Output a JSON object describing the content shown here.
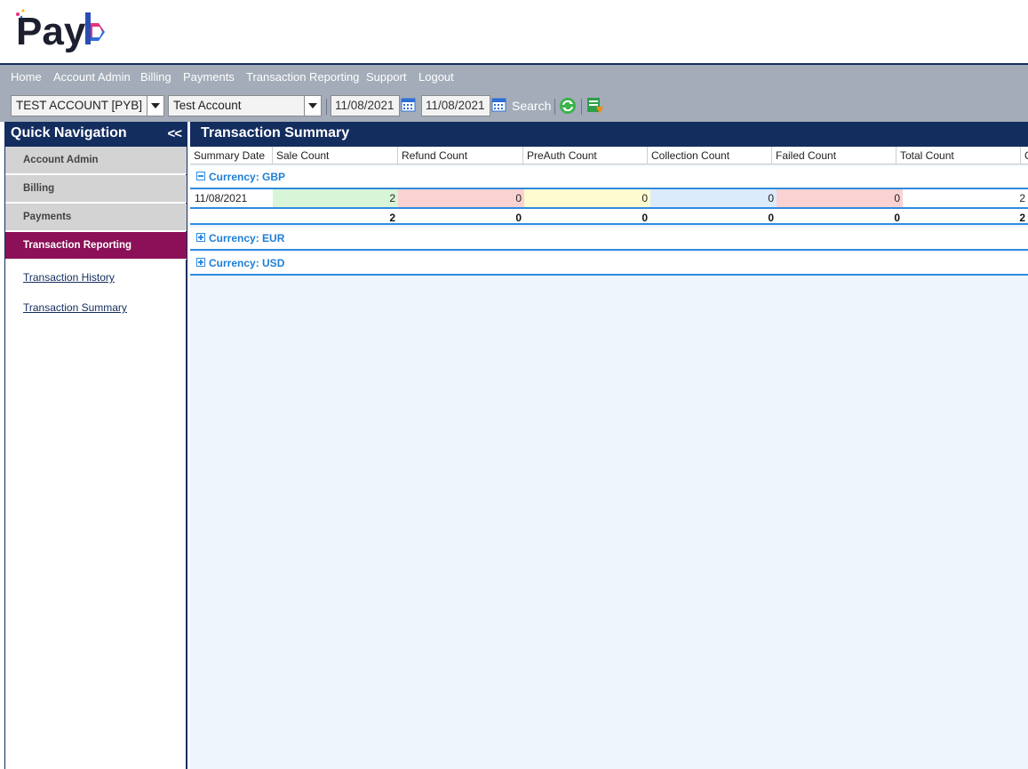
{
  "brand": {
    "logo_text": "Payb",
    "accent_pink": "#8b1057",
    "navy": "#132d5e"
  },
  "topnav": [
    "Home",
    "Account Admin",
    "Billing",
    "Payments",
    "Transaction Reporting",
    "Support",
    "Logout"
  ],
  "toolbar": {
    "account_select": "TEST ACCOUNT [PYB]",
    "merchant_select": "Test Account",
    "date_from": "11/08/2021",
    "date_to": "11/08/2021",
    "search_label": "Search",
    "icons": [
      "calendar-icon",
      "calendar-icon",
      "refresh-icon",
      "export-icon"
    ]
  },
  "sidebar": {
    "title": "Quick Navigation",
    "collapse_label": "<<",
    "sections": [
      "Account Admin",
      "Billing",
      "Payments",
      "Transaction Reporting"
    ],
    "active_section": "Transaction Reporting",
    "links": [
      "Transaction History",
      "Transaction Summary"
    ]
  },
  "main": {
    "title": "Transaction Summary",
    "columns": [
      "Summary Date",
      "Sale Count",
      "Refund Count",
      "PreAuth Count",
      "Collection Count",
      "Failed Count",
      "Total Count",
      "C"
    ],
    "groups": [
      {
        "label": "Currency: GBP",
        "expanded": true,
        "rows": [
          {
            "date": "11/08/2021",
            "sale": "2",
            "refund": "0",
            "preauth": "0",
            "collection": "0",
            "failed": "0",
            "total": "2"
          }
        ],
        "totals": {
          "sale": "2",
          "refund": "0",
          "preauth": "0",
          "collection": "0",
          "failed": "0",
          "total": "2"
        }
      },
      {
        "label": "Currency: EUR",
        "expanded": false
      },
      {
        "label": "Currency: USD",
        "expanded": false
      }
    ],
    "cell_colors": {
      "sale": "#d8f5d8",
      "refund": "#fbd2d2",
      "preauth": "#fdfbcf",
      "collection": "#dcebfb",
      "failed": "#fbd2d2"
    }
  }
}
